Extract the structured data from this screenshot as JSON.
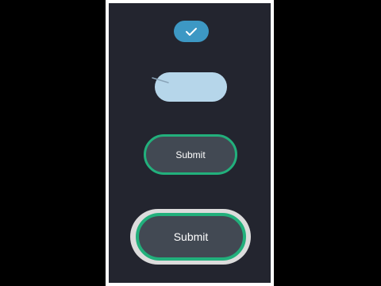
{
  "stages": {
    "check": {
      "icon": "checkmark-icon",
      "color": "#3d98c4"
    },
    "morph": {
      "color": "#b6d6ea"
    },
    "submit_medium": {
      "label": "Submit"
    },
    "submit_large": {
      "label": "Submit"
    }
  },
  "colors": {
    "background": "#23252f",
    "button_fill": "#424953",
    "button_border": "#22b07c",
    "halo": "#dcdcdc"
  }
}
